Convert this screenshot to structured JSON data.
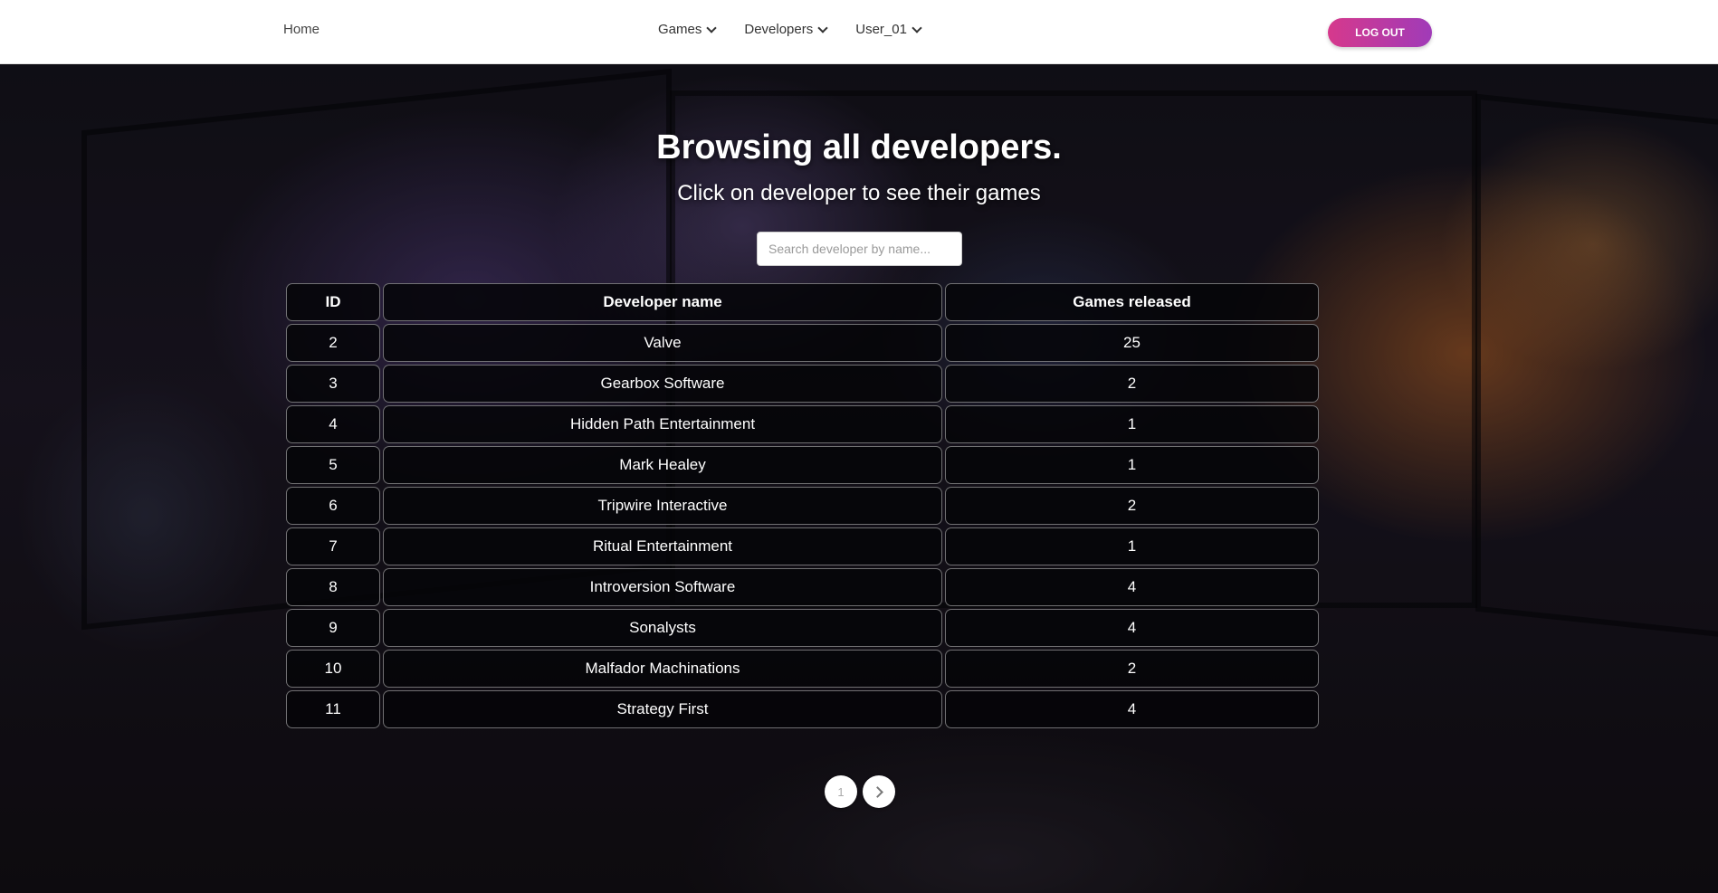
{
  "nav": {
    "home": "Home",
    "menu": [
      {
        "label": "Games"
      },
      {
        "label": "Developers"
      },
      {
        "label": "User_01"
      }
    ],
    "logout": "LOG OUT"
  },
  "hero": {
    "title": "Browsing all developers.",
    "subtitle": "Click on developer to see their games"
  },
  "search": {
    "placeholder": "Search developer by name...",
    "value": ""
  },
  "table": {
    "headers": {
      "id": "ID",
      "name": "Developer name",
      "games": "Games released"
    },
    "rows": [
      {
        "id": "2",
        "name": "Valve",
        "games": "25"
      },
      {
        "id": "3",
        "name": "Gearbox Software",
        "games": "2"
      },
      {
        "id": "4",
        "name": "Hidden Path Entertainment",
        "games": "1"
      },
      {
        "id": "5",
        "name": "Mark Healey",
        "games": "1"
      },
      {
        "id": "6",
        "name": "Tripwire Interactive",
        "games": "2"
      },
      {
        "id": "7",
        "name": "Ritual Entertainment",
        "games": "1"
      },
      {
        "id": "8",
        "name": "Introversion Software",
        "games": "4"
      },
      {
        "id": "9",
        "name": "Sonalysts",
        "games": "4"
      },
      {
        "id": "10",
        "name": "Malfador Machinations",
        "games": "2"
      },
      {
        "id": "11",
        "name": "Strategy First",
        "games": "4"
      }
    ]
  },
  "pagination": {
    "current_page": "1",
    "next_icon": "chevron-right-icon"
  },
  "colors": {
    "logout_gradient_start": "#d6398c",
    "logout_gradient_end": "#a03bb8",
    "cell_background": "#050508"
  }
}
